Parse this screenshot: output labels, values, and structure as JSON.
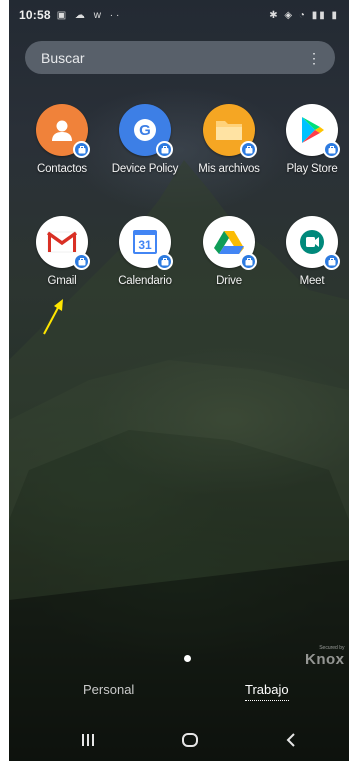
{
  "status_bar": {
    "time": "10:58"
  },
  "search": {
    "placeholder": "Buscar"
  },
  "apps": [
    {
      "label": "Contactos",
      "icon": "contacts-icon",
      "color": "#f0823a"
    },
    {
      "label": "Device Policy",
      "icon": "device-policy-icon",
      "color": "#3d7fe6"
    },
    {
      "label": "Mis archivos",
      "icon": "my-files-icon",
      "color": "#f5a623"
    },
    {
      "label": "Play Store",
      "icon": "play-store-icon",
      "color": "#ffffff"
    },
    {
      "label": "Gmail",
      "icon": "gmail-icon",
      "color": "#ffffff"
    },
    {
      "label": "Calendario",
      "icon": "calendar-icon",
      "color": "#ffffff",
      "day": "31"
    },
    {
      "label": "Drive",
      "icon": "drive-icon",
      "color": "#ffffff"
    },
    {
      "label": "Meet",
      "icon": "meet-icon",
      "color": "#ffffff"
    }
  ],
  "watermark": {
    "small": "Secured by",
    "big": "Knox"
  },
  "tabs": {
    "personal": "Personal",
    "trabajo": "Trabajo"
  },
  "colors": {
    "work_badge": "#2d7be0",
    "pointer_arrow": "#ffe600"
  }
}
